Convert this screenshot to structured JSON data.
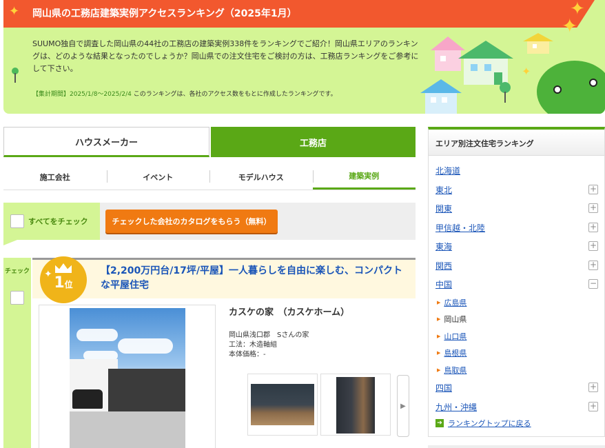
{
  "banner": {
    "title": "岡山県の工務店建築実例アクセスランキング（2025年1月）",
    "description": "SUUMO独自で調査した岡山県の44社の工務店の建築実例338件をランキングでご紹介！岡山県エリアのランキングは、どのような結果となったのでしょうか？岡山県での注文住宅をご検討の方は、工務店ランキングをご参考にして下さい。",
    "period_label": "【集計期間】2025/1/8〜2025/2/4",
    "period_note": "このランキングは、各社のアクセス数をもとに作成したランキングです。"
  },
  "main_tabs": [
    {
      "label": "ハウスメーカー",
      "active": false
    },
    {
      "label": "工務店",
      "active": true
    }
  ],
  "sub_tabs": [
    {
      "label": "施工会社",
      "active": false
    },
    {
      "label": "イベント",
      "active": false
    },
    {
      "label": "モデルハウス",
      "active": false
    },
    {
      "label": "建築実例",
      "active": true
    }
  ],
  "checkbar": {
    "check_all_label": "すべてをチェック",
    "catalog_button": "チェックした会社のカタログをもらう（無料）"
  },
  "ranking_item": {
    "check_label": "チェック",
    "rank_number": "1",
    "rank_suffix": "位",
    "title": "【2,200万円台/17坪/平屋】一人暮らしを自由に楽しむ、コンパクトな平屋住宅",
    "name": "カスケの家　（カスケホーム）",
    "location": "岡山県浅口郡　Sさんの家",
    "construction": "工法：木造軸組",
    "price": "本体価格：-",
    "next_glyph": "▶"
  },
  "sidebar": {
    "heading": "エリア別注文住宅ランキング",
    "regions": [
      {
        "label": "北海道",
        "toggle": ""
      },
      {
        "label": "東北",
        "toggle": "+"
      },
      {
        "label": "関東",
        "toggle": "+"
      },
      {
        "label": "甲信越・北陸",
        "toggle": "+"
      },
      {
        "label": "東海",
        "toggle": "+"
      },
      {
        "label": "関西",
        "toggle": "+"
      },
      {
        "label": "中国",
        "toggle": "−"
      }
    ],
    "prefectures": [
      {
        "label": "広島県",
        "link": true
      },
      {
        "label": "岡山県",
        "link": false
      },
      {
        "label": "山口県",
        "link": true
      },
      {
        "label": "島根県",
        "link": true
      },
      {
        "label": "鳥取県",
        "link": true
      }
    ],
    "regions_after": [
      {
        "label": "四国",
        "toggle": "+"
      },
      {
        "label": "九州・沖縄",
        "toggle": "+"
      }
    ],
    "back_link": "ランキングトップに戻る"
  },
  "colors": {
    "accent_green": "#5aa816",
    "banner_orange": "#f2582e",
    "button_orange": "#f07a12",
    "link_blue": "#1a55b8",
    "rank_gold": "#f0b419"
  }
}
